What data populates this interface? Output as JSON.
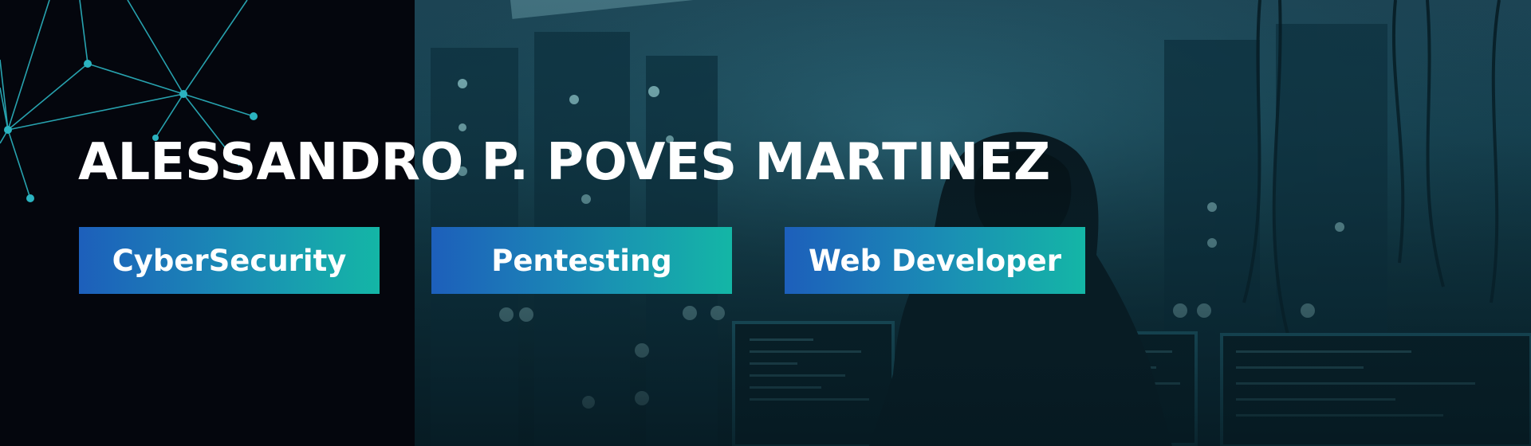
{
  "banner": {
    "name": "ALESSANDRO P. POVES MARTINEZ",
    "tags": [
      {
        "label": "CyberSecurity"
      },
      {
        "label": "Pentesting"
      },
      {
        "label": "Web Developer"
      }
    ]
  },
  "colors": {
    "background": "#04060c",
    "network_line": "#2bb3c0",
    "tag_gradient_start": "#1d5fbb",
    "tag_gradient_end": "#14b6a6",
    "text": "#ffffff"
  }
}
